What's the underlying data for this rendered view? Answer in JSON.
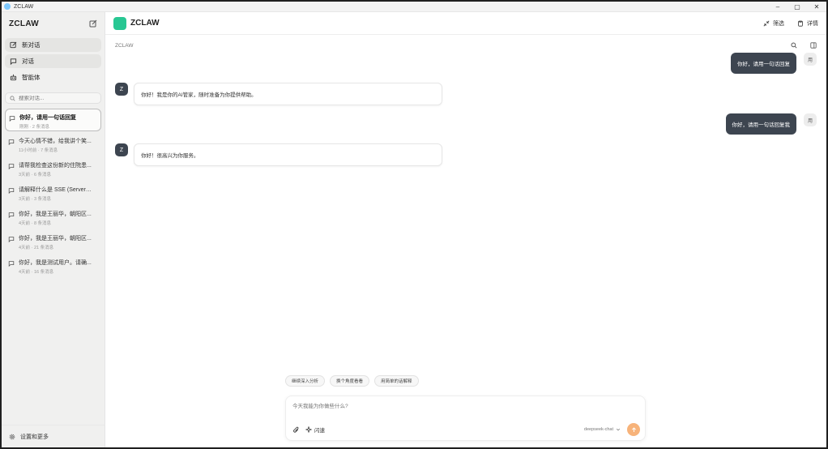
{
  "window": {
    "title": "ZCLAW",
    "min": "–",
    "max": "▢",
    "close": "✕"
  },
  "sidebar": {
    "title": "ZCLAW",
    "nav": [
      {
        "label": "新对话"
      },
      {
        "label": "对话"
      },
      {
        "label": "智能体"
      }
    ],
    "search_placeholder": "搜索对话...",
    "conversations": [
      {
        "title": "你好，请用一句话回复",
        "meta": "刚刚 · 2 条消息"
      },
      {
        "title": "今天心情不错，给我讲个笑...",
        "meta": "11小时前 · 7 条消息"
      },
      {
        "title": "请帮我检查这份新的住院患...",
        "meta": "3天前 · 6 条消息"
      },
      {
        "title": "请解释什么是 SSE (Server-Se...",
        "meta": "3天前 · 3 条消息"
      },
      {
        "title": "你好，我是王丽华，朝阳区...",
        "meta": "4天前 · 8 条消息"
      },
      {
        "title": "你好，我是王丽华，朝阳区...",
        "meta": "4天前 · 21 条消息"
      },
      {
        "title": "你好，我是测试用户。请确...",
        "meta": "4天前 · 16 条消息"
      }
    ],
    "footer": "设置和更多"
  },
  "topbar": {
    "brand": "ZCLAW",
    "filter": "筛选",
    "details": "详情"
  },
  "subbar": {
    "crumb": "ZCLAW"
  },
  "messages": [
    {
      "role": "user",
      "text": "你好，请用一句话回复",
      "avatar": "用"
    },
    {
      "role": "bot",
      "text": "你好！我是你的AI管家，随时准备为你提供帮助。",
      "avatar": "Z"
    },
    {
      "role": "user",
      "text": "你好，请用一句话回复我",
      "avatar": "用"
    },
    {
      "role": "bot",
      "text": "你好！很高兴为你服务。",
      "avatar": "Z"
    }
  ],
  "suggestions": [
    "继续深入分析",
    "换个角度看看",
    "用简单的话解释"
  ],
  "composer": {
    "placeholder": "今天我能为你做些什么?",
    "mode": "闪速",
    "model": "deepseek-chat"
  }
}
